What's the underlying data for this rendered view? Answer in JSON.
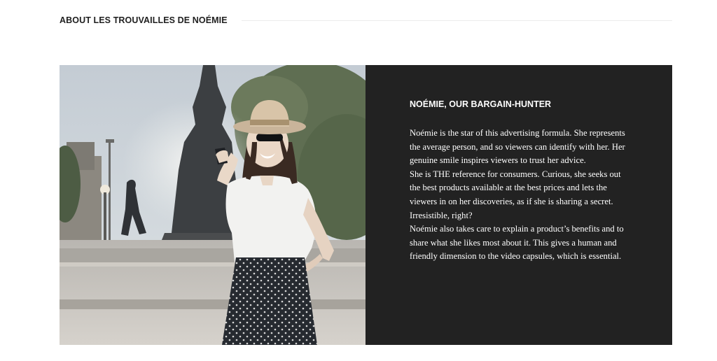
{
  "section": {
    "title": "ABOUT LES TROUVAILLES DE NOÉMIE"
  },
  "feature": {
    "image_alt": "Noémie taking a selfie in front of a fountain",
    "heading": "NOÉMIE, OUR BARGAIN-HUNTER",
    "paragraphs": [
      "Noémie is the star of this advertising formula. She represents the average person, and so viewers can identify with her. Her genuine smile inspires viewers to trust her advice.",
      "She is THE reference for consumers. Curious, she seeks out the best products available at the best prices and lets the viewers in on her discoveries, as if she is sharing a secret. Irresistible, right?",
      "Noémie also takes care to explain a product’s benefits and to share what she likes most about it. This gives a human and friendly dimension to the video capsules, which is essential."
    ]
  },
  "colors": {
    "panel_background": "#222222",
    "heading_text": "#1f1f1f",
    "panel_text": "#ffffff"
  }
}
